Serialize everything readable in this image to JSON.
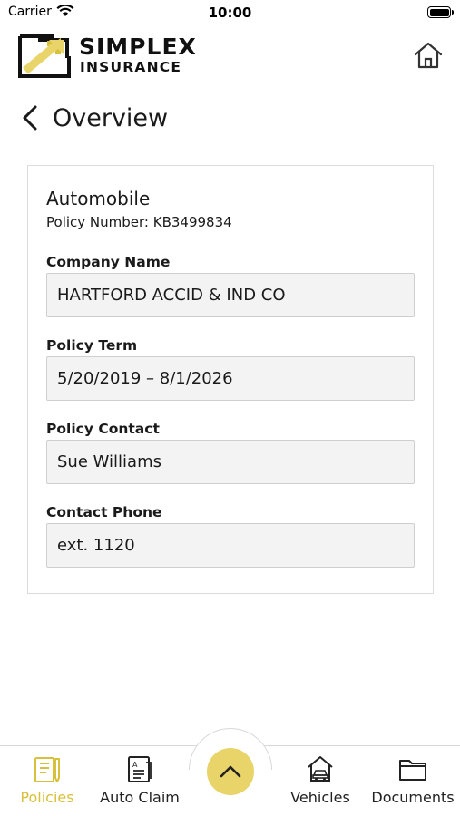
{
  "status_bar": {
    "carrier": "Carrier",
    "time": "10:00"
  },
  "header": {
    "logo_word1": "SIMPLEX",
    "logo_word2": "INSURANCE"
  },
  "nav": {
    "title": "Overview"
  },
  "policy": {
    "type": "Automobile",
    "number_line": "Policy Number: KB3499834",
    "fields": [
      {
        "label": "Company Name",
        "value": "HARTFORD ACCID & IND CO"
      },
      {
        "label": "Policy Term",
        "value": "5/20/2019 – 8/1/2026"
      },
      {
        "label": "Policy Contact",
        "value": "Sue Williams"
      },
      {
        "label": "Contact Phone",
        "value": "ext. 1120"
      }
    ]
  },
  "tabbar": {
    "tabs": [
      {
        "label": "Policies",
        "icon": "policies-icon",
        "active": true
      },
      {
        "label": "Auto Claim",
        "icon": "auto-claim-icon",
        "active": false
      },
      {
        "label": "Vehicles",
        "icon": "vehicles-icon",
        "active": false
      },
      {
        "label": "Documents",
        "icon": "documents-icon",
        "active": false
      }
    ],
    "center_icon": "chevron-up-icon"
  },
  "colors": {
    "accent": "#E8D468",
    "active_tab": "#D8C03A",
    "field_bg": "#F3F3F3"
  }
}
